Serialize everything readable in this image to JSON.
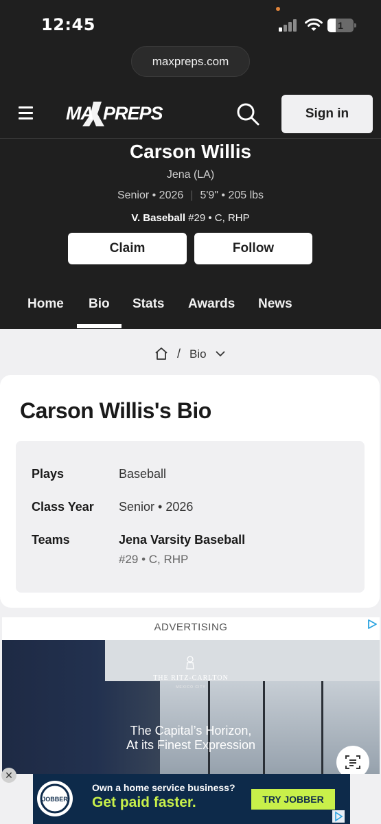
{
  "status_bar": {
    "time": "12:45",
    "battery": "1"
  },
  "browser": {
    "url": "maxpreps.com"
  },
  "header": {
    "logo": "MAXPREPS",
    "signin_label": "Sign in"
  },
  "player": {
    "name": "Carson Willis",
    "school": "Jena (LA)",
    "class_info": "Senior • 2026",
    "size_info": "5'9\" • 205 lbs",
    "team_sport": "V. Baseball",
    "team_detail": "#29 • C, RHP",
    "claim_label": "Claim",
    "follow_label": "Follow"
  },
  "tabs": [
    {
      "label": "Home"
    },
    {
      "label": "Bio",
      "active": true
    },
    {
      "label": "Stats"
    },
    {
      "label": "Awards"
    },
    {
      "label": "News"
    }
  ],
  "breadcrumb": {
    "separator": "/",
    "current": "Bio"
  },
  "bio": {
    "title": "Carson Willis's Bio",
    "rows": [
      {
        "label": "Plays",
        "value": "Baseball"
      },
      {
        "label": "Class Year",
        "value": "Senior • 2026"
      },
      {
        "label": "Teams",
        "value": "Jena Varsity Baseball",
        "sub": "#29 • C, RHP"
      }
    ]
  },
  "ad": {
    "label": "ADVERTISING",
    "brand": "THE RITZ-CARLTON",
    "brand_sub": "MEXICO CITY",
    "tagline1": "The Capital’s Horizon,",
    "tagline2": "At its Finest Expression"
  },
  "banner": {
    "logo": "JOBBER",
    "line1": "Own a home service business?",
    "line2": "Get paid faster.",
    "cta": "TRY JOBBER",
    "close": "✕"
  },
  "colors": {
    "dark_bg": "#1f1f1f",
    "light_bg": "#f0f0f2",
    "jobber_navy": "#0d2a4a",
    "jobber_lime": "#c8f04a"
  }
}
